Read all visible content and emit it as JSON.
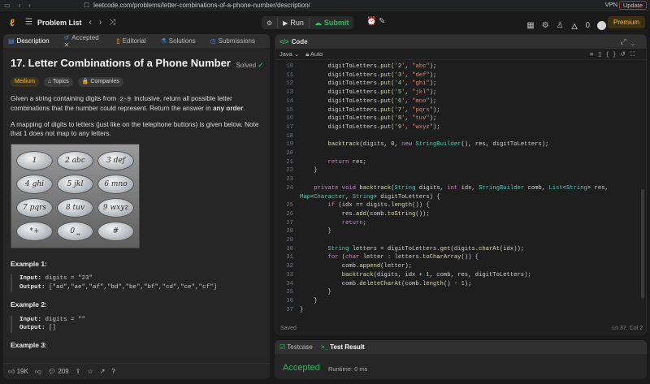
{
  "browser": {
    "url": "leetcode.com/problems/letter-combinations-of-a-phone-number/description/",
    "vpn": "VPN",
    "update": "Update"
  },
  "nav": {
    "problem_list": "Problem List",
    "run": "Run",
    "submit": "Submit",
    "streak": "0",
    "premium": "Premium"
  },
  "tabs": {
    "description": "Description",
    "accepted": "Accepted",
    "editorial": "Editorial",
    "solutions": "Solutions",
    "submissions": "Submissions"
  },
  "problem": {
    "title": "17. Letter Combinations of a Phone Number",
    "status": "Solved",
    "difficulty": "Medium",
    "topics": "Topics",
    "companies": "Companies",
    "p1_a": "Given a string containing digits from ",
    "p1_code": "2-9",
    "p1_b": " inclusive, return all possible letter combinations that the number could represent. Return the answer in ",
    "p1_bold": "any order",
    "p1_end": ".",
    "p2": "A mapping of digits to letters (just like on the telephone buttons) is given below. Note that 1 does not map to any letters.",
    "keys": [
      "1",
      "2 abc",
      "3 def",
      "4 ghi",
      "5 jkl",
      "6 mno",
      "7 pqrs",
      "8 tuv",
      "9 wxyz",
      "*+",
      "0 ⎵",
      "#"
    ],
    "example1_title": "Example 1:",
    "example1_input": "digits = \"23\"",
    "example1_output": "[\"ad\",\"ae\",\"af\",\"bd\",\"be\",\"bf\",\"cd\",\"ce\",\"cf\"]",
    "example2_title": "Example 2:",
    "example2_input": "digits = \"\"",
    "example2_output": "[]",
    "example3_title": "Example 3:",
    "input_label": "Input:",
    "output_label": "Output:"
  },
  "footer_left": {
    "likes": "19K",
    "comments": "209"
  },
  "editor": {
    "header": "Code",
    "language": "Java",
    "mode": "Auto",
    "saved": "Saved",
    "cursor": "Ln 37, Col 2",
    "lines": [
      {
        "n": "10",
        "code": "        digitToLetters.put('2', \"abc\");"
      },
      {
        "n": "11",
        "code": "        digitToLetters.put('3', \"def\");"
      },
      {
        "n": "12",
        "code": "        digitToLetters.put('4', \"ghi\");"
      },
      {
        "n": "13",
        "code": "        digitToLetters.put('5', \"jkl\");"
      },
      {
        "n": "14",
        "code": "        digitToLetters.put('6', \"mno\");"
      },
      {
        "n": "15",
        "code": "        digitToLetters.put('7', \"pqrs\");"
      },
      {
        "n": "16",
        "code": "        digitToLetters.put('8', \"tuv\");"
      },
      {
        "n": "17",
        "code": "        digitToLetters.put('9', \"wxyz\");"
      },
      {
        "n": "18",
        "code": ""
      },
      {
        "n": "19",
        "code": "        backtrack(digits, 0, new StringBuilder(), res, digitToLetters);"
      },
      {
        "n": "20",
        "code": ""
      },
      {
        "n": "21",
        "code": "        return res;"
      },
      {
        "n": "22",
        "code": "    }"
      },
      {
        "n": "23",
        "code": ""
      },
      {
        "n": "24",
        "code": "    private void backtrack(String digits, int idx, StringBuilder comb, List<String> res,"
      },
      {
        "n": "",
        "code": "Map<Character, String> digitToLetters) {"
      },
      {
        "n": "25",
        "code": "        if (idx == digits.length()) {"
      },
      {
        "n": "26",
        "code": "            res.add(comb.toString());"
      },
      {
        "n": "27",
        "code": "            return;"
      },
      {
        "n": "28",
        "code": "        }"
      },
      {
        "n": "29",
        "code": ""
      },
      {
        "n": "30",
        "code": "        String letters = digitToLetters.get(digits.charAt(idx));"
      },
      {
        "n": "31",
        "code": "        for (char letter : letters.toCharArray()) {"
      },
      {
        "n": "32",
        "code": "            comb.append(letter);"
      },
      {
        "n": "33",
        "code": "            backtrack(digits, idx + 1, comb, res, digitToLetters);"
      },
      {
        "n": "34",
        "code": "            comb.deleteCharAt(comb.length() - 1);"
      },
      {
        "n": "35",
        "code": "        }"
      },
      {
        "n": "36",
        "code": "    }"
      },
      {
        "n": "37",
        "code": "}"
      }
    ]
  },
  "test": {
    "testcase_tab": "Testcase",
    "result_tab": "Test Result",
    "result": "Accepted",
    "runtime": "Runtime: 0 ms"
  },
  "colors": {
    "accent_green": "#2cbb5d",
    "medium": "#f5b93d",
    "premium": "#f5b93d"
  }
}
